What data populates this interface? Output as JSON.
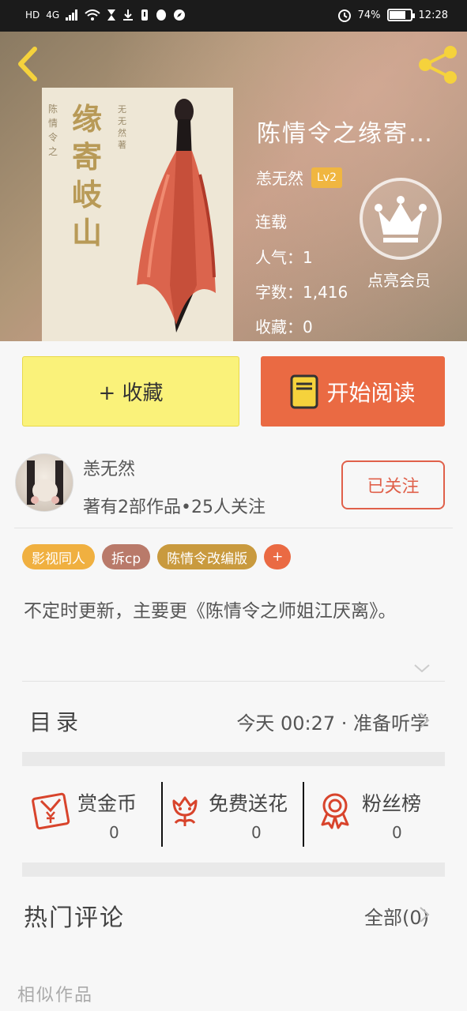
{
  "status_bar": {
    "left_icons": [
      "HD",
      "4G",
      "signal-icon",
      "wifi-icon",
      "hourglass-icon",
      "download-icon",
      "alert-icon",
      "qq-icon",
      "compass-icon"
    ],
    "alarm_icon": "alarm-icon",
    "battery": "74%",
    "battery_level": 0.74,
    "time": "12:28"
  },
  "header": {
    "back_icon": "chevron-left-icon",
    "share_icon": "share-icon",
    "cover": {
      "title_text": "缘寄岐山",
      "subtitle_text": "陈情令之",
      "author_text": "无无然著"
    },
    "book_title": "陈情令之缘寄…",
    "author": "恙无然",
    "level": "Lv2",
    "status": "连载",
    "popularity": "人气：1",
    "word_count": "字数：1,416",
    "collections": "收藏：0",
    "vip_icon": "crown-icon",
    "vip_label": "点亮会员"
  },
  "actions": {
    "collect": "+ 收藏",
    "read": "开始阅读",
    "read_icon": "book-icon"
  },
  "author_card": {
    "name": "恙无然",
    "stats": "著有2部作品•25人关注",
    "follow": "已关注"
  },
  "tags": [
    {
      "label": "影视同人",
      "color": "#f0b040"
    },
    {
      "label": "拆cp",
      "color": "#b97a6a"
    },
    {
      "label": "陈情令改编版",
      "color": "#c99a3e"
    },
    {
      "label": "+",
      "color": "#ea6a43"
    }
  ],
  "description": "不定时更新，主要更《陈情令之师姐江厌离》。",
  "toc": {
    "label": "目录",
    "latest": "今天 00:27 · 准备听学"
  },
  "rewards": [
    {
      "label": "赏金币",
      "count": "0",
      "icon": "red-envelope-icon"
    },
    {
      "label": "免费送花",
      "count": "0",
      "icon": "flower-icon"
    },
    {
      "label": "粉丝榜",
      "count": "0",
      "icon": "medal-icon"
    }
  ],
  "comments": {
    "label": "热门评论",
    "all": "全部(0)"
  },
  "similar": "相似作品"
}
